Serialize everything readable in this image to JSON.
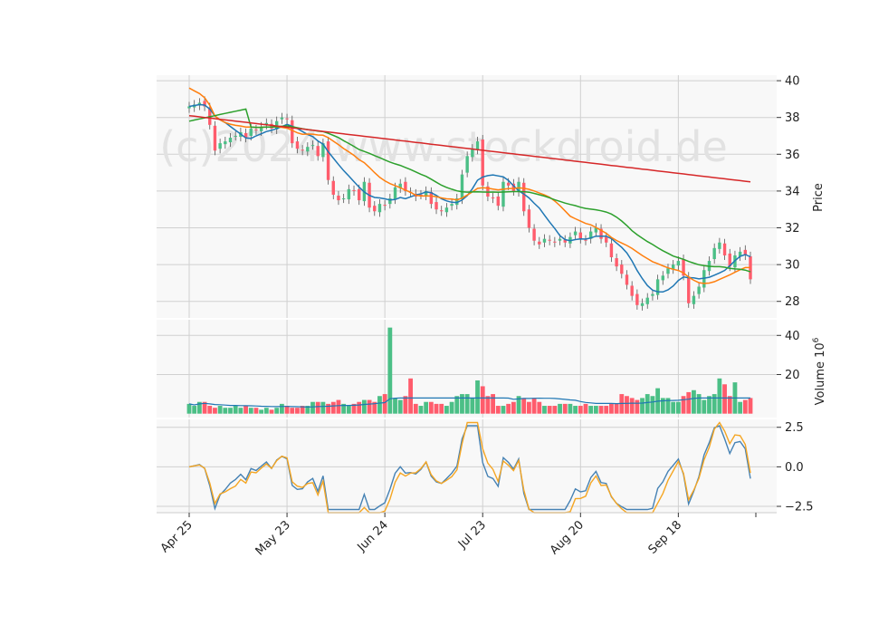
{
  "watermark": "(c)2024 www.stockdroid.de",
  "chart_data": {
    "type": "candlestick",
    "grid": true,
    "price_panel": {
      "ylabel": "Price",
      "ylim": [
        27.1,
        40.3
      ],
      "yticks": [
        28,
        30,
        32,
        34,
        36,
        38,
        40
      ],
      "colors": {
        "up": "#4bbf86",
        "down": "#ff5c6c",
        "sma_short": "#1f77b4",
        "sma_mid": "#ff7f0e",
        "sma_long": "#2ca02c",
        "sma_longest": "#d62728"
      },
      "closes": [
        38.6,
        38.7,
        38.8,
        38.6,
        37.6,
        36.2,
        36.6,
        36.7,
        36.9,
        37.0,
        37.2,
        36.9,
        37.4,
        37.3,
        37.5,
        37.7,
        37.4,
        37.8,
        38.0,
        37.9,
        36.6,
        36.3,
        36.2,
        36.4,
        36.5,
        35.9,
        36.6,
        34.6,
        33.8,
        33.5,
        33.6,
        34.1,
        34.0,
        33.5,
        34.5,
        33.1,
        32.9,
        33.3,
        33.2,
        33.6,
        34.2,
        34.4,
        34.0,
        33.9,
        33.7,
        33.8,
        34.0,
        33.3,
        33.0,
        32.9,
        33.1,
        33.3,
        33.6,
        34.9,
        35.9,
        36.3,
        36.7,
        34.3,
        33.7,
        33.6,
        33.2,
        34.5,
        34.3,
        34.0,
        34.5,
        32.9,
        32.0,
        31.3,
        31.1,
        31.4,
        31.3,
        31.2,
        31.4,
        31.2,
        31.5,
        31.8,
        31.4,
        31.3,
        31.8,
        32.0,
        31.4,
        31.2,
        30.4,
        29.9,
        29.5,
        28.9,
        28.3,
        27.8,
        27.9,
        28.2,
        28.4,
        29.2,
        29.4,
        29.8,
        30.0,
        30.2,
        29.4,
        27.9,
        28.3,
        28.8,
        29.7,
        30.2,
        30.9,
        31.2,
        30.5,
        29.9,
        30.5,
        30.7,
        30.5,
        29.2
      ]
    },
    "volume_panel": {
      "ylabel": "Volume 10^6",
      "ylabel_base": "Volume 10",
      "ylabel_exp": "6",
      "ylim": [
        -2,
        48
      ],
      "yticks": [
        20,
        40
      ],
      "values": [
        5,
        4,
        6,
        6,
        4,
        3,
        4,
        3,
        3,
        4,
        3,
        4,
        3,
        3,
        2,
        3,
        2,
        3,
        5,
        4,
        3,
        3,
        4,
        4,
        6,
        6,
        6,
        5,
        6,
        7,
        5,
        4,
        5,
        6,
        7,
        7,
        6,
        9,
        10,
        44,
        8,
        7,
        9,
        18,
        5,
        4,
        6,
        6,
        5,
        5,
        4,
        6,
        9,
        10,
        10,
        8,
        17,
        14,
        9,
        10,
        4,
        4,
        5,
        6,
        9,
        8,
        6,
        8,
        6,
        4,
        4,
        4,
        5,
        5,
        5,
        4,
        4,
        5,
        4,
        4,
        4,
        4,
        5,
        5,
        10,
        9,
        8,
        7,
        8,
        10,
        9,
        13,
        8,
        8,
        6,
        6,
        9,
        11,
        12,
        10,
        7,
        9,
        10,
        18,
        15,
        9,
        16,
        6,
        7,
        8
      ]
    },
    "oscillator_panel": {
      "ylim": [
        -2.9,
        3.0
      ],
      "yticks": [
        -2.5,
        0.0,
        2.5
      ],
      "line_colors": [
        "#4682b4",
        "#f5a623"
      ]
    },
    "x_tick_labels": [
      "Apr 25",
      "May 23",
      "Jun 24",
      "Jul 23",
      "Aug 20",
      "Sep 18"
    ],
    "x_tick_index": [
      0,
      19,
      38,
      57,
      76,
      95
    ]
  }
}
